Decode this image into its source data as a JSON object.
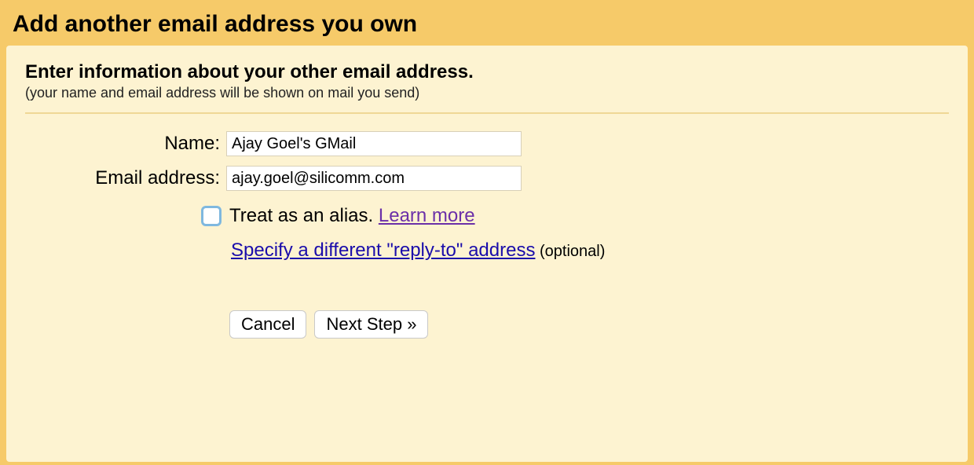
{
  "title": "Add another email address you own",
  "panel": {
    "heading": "Enter information about your other email address.",
    "sub": "(your name and email address will be shown on mail you send)"
  },
  "form": {
    "name_label": "Name:",
    "name_value": "Ajay Goel's GMail",
    "email_label": "Email address:",
    "email_value": "ajay.goel@silicomm.com",
    "alias_text": "Treat as an alias. ",
    "learn_more": "Learn more",
    "reply_to_link": "Specify a different \"reply-to\" address",
    "optional": " (optional)"
  },
  "buttons": {
    "cancel": "Cancel",
    "next": "Next Step »"
  }
}
